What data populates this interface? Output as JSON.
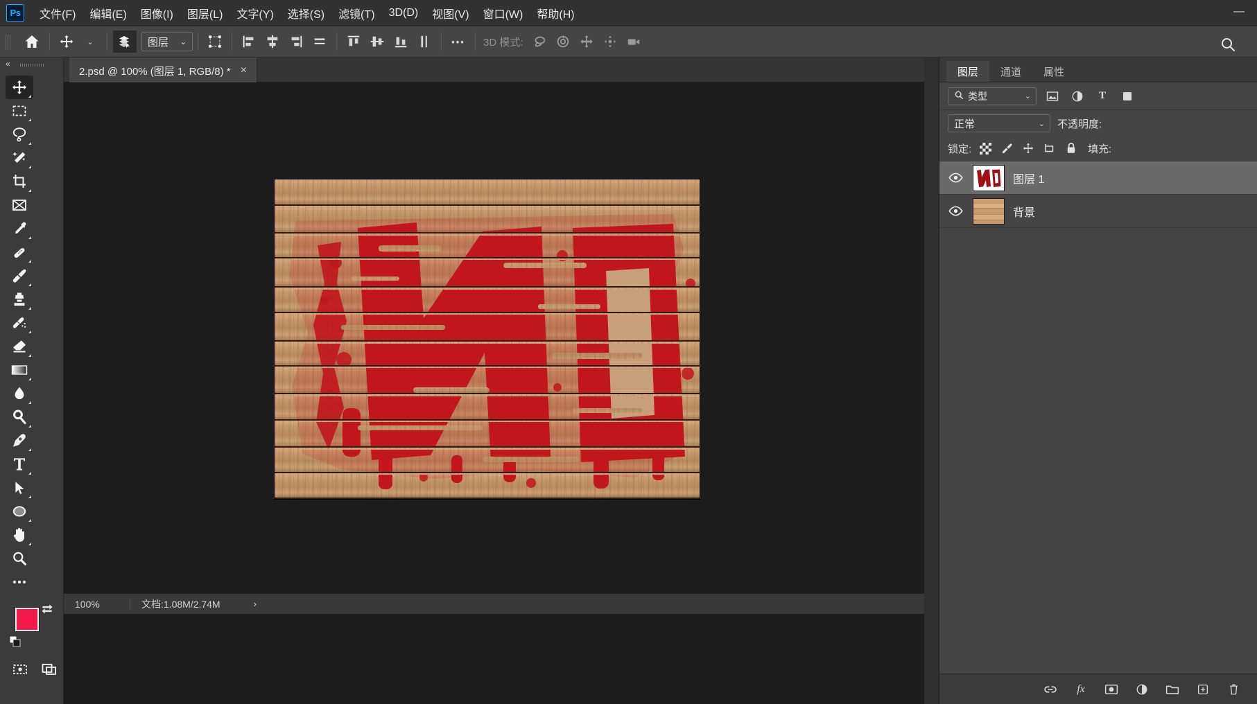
{
  "app": {
    "name": "Ps",
    "minimize": "—"
  },
  "menubar": {
    "items": [
      {
        "label": "文件(F)"
      },
      {
        "label": "编辑(E)"
      },
      {
        "label": "图像(I)"
      },
      {
        "label": "图层(L)"
      },
      {
        "label": "文字(Y)"
      },
      {
        "label": "选择(S)"
      },
      {
        "label": "滤镜(T)"
      },
      {
        "label": "3D(D)"
      },
      {
        "label": "视图(V)"
      },
      {
        "label": "窗口(W)"
      },
      {
        "label": "帮助(H)"
      }
    ]
  },
  "optionsbar": {
    "home_icon": "home-icon",
    "move_tool_icon": "move-tool-icon",
    "auto_select_icon": "auto-select-layers-icon",
    "layer_target": "图层",
    "transform_controls_icon": "show-transform-controls-icon",
    "align": [
      "align-left-edges-icon",
      "align-horizontal-centers-icon",
      "align-right-edges-icon",
      "align-top-edges-icon",
      "align-vertical-centers-icon",
      "align-bottom-edges-icon",
      "distribute-vertical-icon",
      "distribute-horizontal-icon"
    ],
    "more_label": "•••",
    "mode3d_label": "3D 模式:",
    "mode3d_icons": [
      "orbit-3d-icon",
      "roll-3d-icon",
      "pan-3d-icon",
      "slide-3d-icon",
      "camera-3d-icon"
    ],
    "search_icon": "search-icon"
  },
  "toolbar": {
    "collapse_icon": "«",
    "tools": [
      {
        "name": "move-tool",
        "icon": "move",
        "active": true
      },
      {
        "name": "rectangular-marquee-tool",
        "icon": "marquee",
        "active": false
      },
      {
        "name": "lasso-tool",
        "icon": "lasso",
        "active": false
      },
      {
        "name": "magic-wand-tool",
        "icon": "wand",
        "active": false
      },
      {
        "name": "crop-tool",
        "icon": "crop",
        "active": false
      },
      {
        "name": "frame-tool",
        "icon": "frame",
        "active": false
      },
      {
        "name": "eyedropper-tool",
        "icon": "eyedropper",
        "active": false
      },
      {
        "name": "healing-brush-tool",
        "icon": "healing",
        "active": false
      },
      {
        "name": "brush-tool",
        "icon": "brush",
        "active": false
      },
      {
        "name": "clone-stamp-tool",
        "icon": "stamp",
        "active": false
      },
      {
        "name": "history-brush-tool",
        "icon": "historybrush",
        "active": false
      },
      {
        "name": "eraser-tool",
        "icon": "eraser",
        "active": false
      },
      {
        "name": "gradient-tool",
        "icon": "gradient",
        "active": false
      },
      {
        "name": "blur-tool",
        "icon": "blur",
        "active": false
      },
      {
        "name": "dodge-tool",
        "icon": "dodge",
        "active": false
      },
      {
        "name": "pen-tool",
        "icon": "pen",
        "active": false
      },
      {
        "name": "type-tool",
        "icon": "type",
        "active": false
      },
      {
        "name": "path-selection-tool",
        "icon": "pathselect",
        "active": false
      },
      {
        "name": "ellipse-shape-tool",
        "icon": "ellipse",
        "active": false
      },
      {
        "name": "hand-tool",
        "icon": "hand",
        "active": false
      },
      {
        "name": "zoom-tool",
        "icon": "zoom",
        "active": false
      },
      {
        "name": "edit-toolbar-button",
        "icon": "more",
        "active": false
      }
    ],
    "foreground_color": "#F4194B",
    "background_color": "#FFFFFF",
    "swap_icon": "swap-colors-icon",
    "reset_icon": "default-colors-icon",
    "quick_mask_icon": "quick-mask-icon",
    "screen_mode_icon": "screen-mode-icon"
  },
  "document": {
    "tab_title": "2.psd @ 100% (图层 1, RGB/8) *",
    "close_label": "×"
  },
  "statusbar": {
    "zoom": "100%",
    "doc_info": "文档:1.08M/2.74M",
    "arrow": "›"
  },
  "panels": {
    "tabs": [
      {
        "label": "图层",
        "active": true
      },
      {
        "label": "通道",
        "active": false
      },
      {
        "label": "属性",
        "active": false
      }
    ],
    "filter": {
      "search_icon": "search-icon",
      "kind_label": "类型",
      "chevron": "⌄",
      "icons": [
        "filter-pixel-icon",
        "filter-adjustment-icon",
        "filter-type-icon",
        "filter-shape-icon"
      ]
    },
    "blend": {
      "mode": "正常",
      "chevron": "⌄",
      "opacity_label": "不透明度:"
    },
    "lock": {
      "label": "锁定:",
      "icons": [
        "lock-transparent-pixels-icon",
        "lock-image-pixels-icon",
        "lock-position-icon",
        "lock-artboard-nesting-icon",
        "lock-all-icon"
      ],
      "fill_label": "填充:"
    },
    "layers": [
      {
        "name": "图层 1",
        "visible": true,
        "selected": true,
        "thumb": "no-stencil"
      },
      {
        "name": "背景",
        "visible": true,
        "selected": false,
        "thumb": "wood"
      }
    ],
    "footer_icons": [
      "link-layers-icon",
      "layer-style-fx-icon",
      "add-layer-mask-icon",
      "new-adjustment-layer-icon",
      "new-group-icon",
      "new-layer-icon",
      "delete-layer-icon"
    ]
  },
  "artwork": {
    "description": "red-stencil-graffiti-on-wood-planks",
    "text": "NO",
    "paint_color": "#C0161C",
    "plank_count": 12
  }
}
